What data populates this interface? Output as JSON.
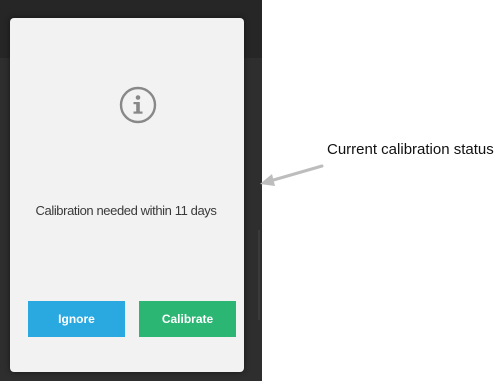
{
  "dialog": {
    "icon": "info-icon",
    "message": "Calibration needed within 11 days",
    "buttons": {
      "ignore_label": "Ignore",
      "calibrate_label": "Calibrate"
    }
  },
  "annotation": {
    "text": "Current calibration status",
    "icon": "arrow-left-icon"
  },
  "colors": {
    "ignore_button": "#2aa8e0",
    "calibrate_button": "#2bb673",
    "dialog_background": "#f2f2f2",
    "backdrop": "#2e2e2e"
  }
}
